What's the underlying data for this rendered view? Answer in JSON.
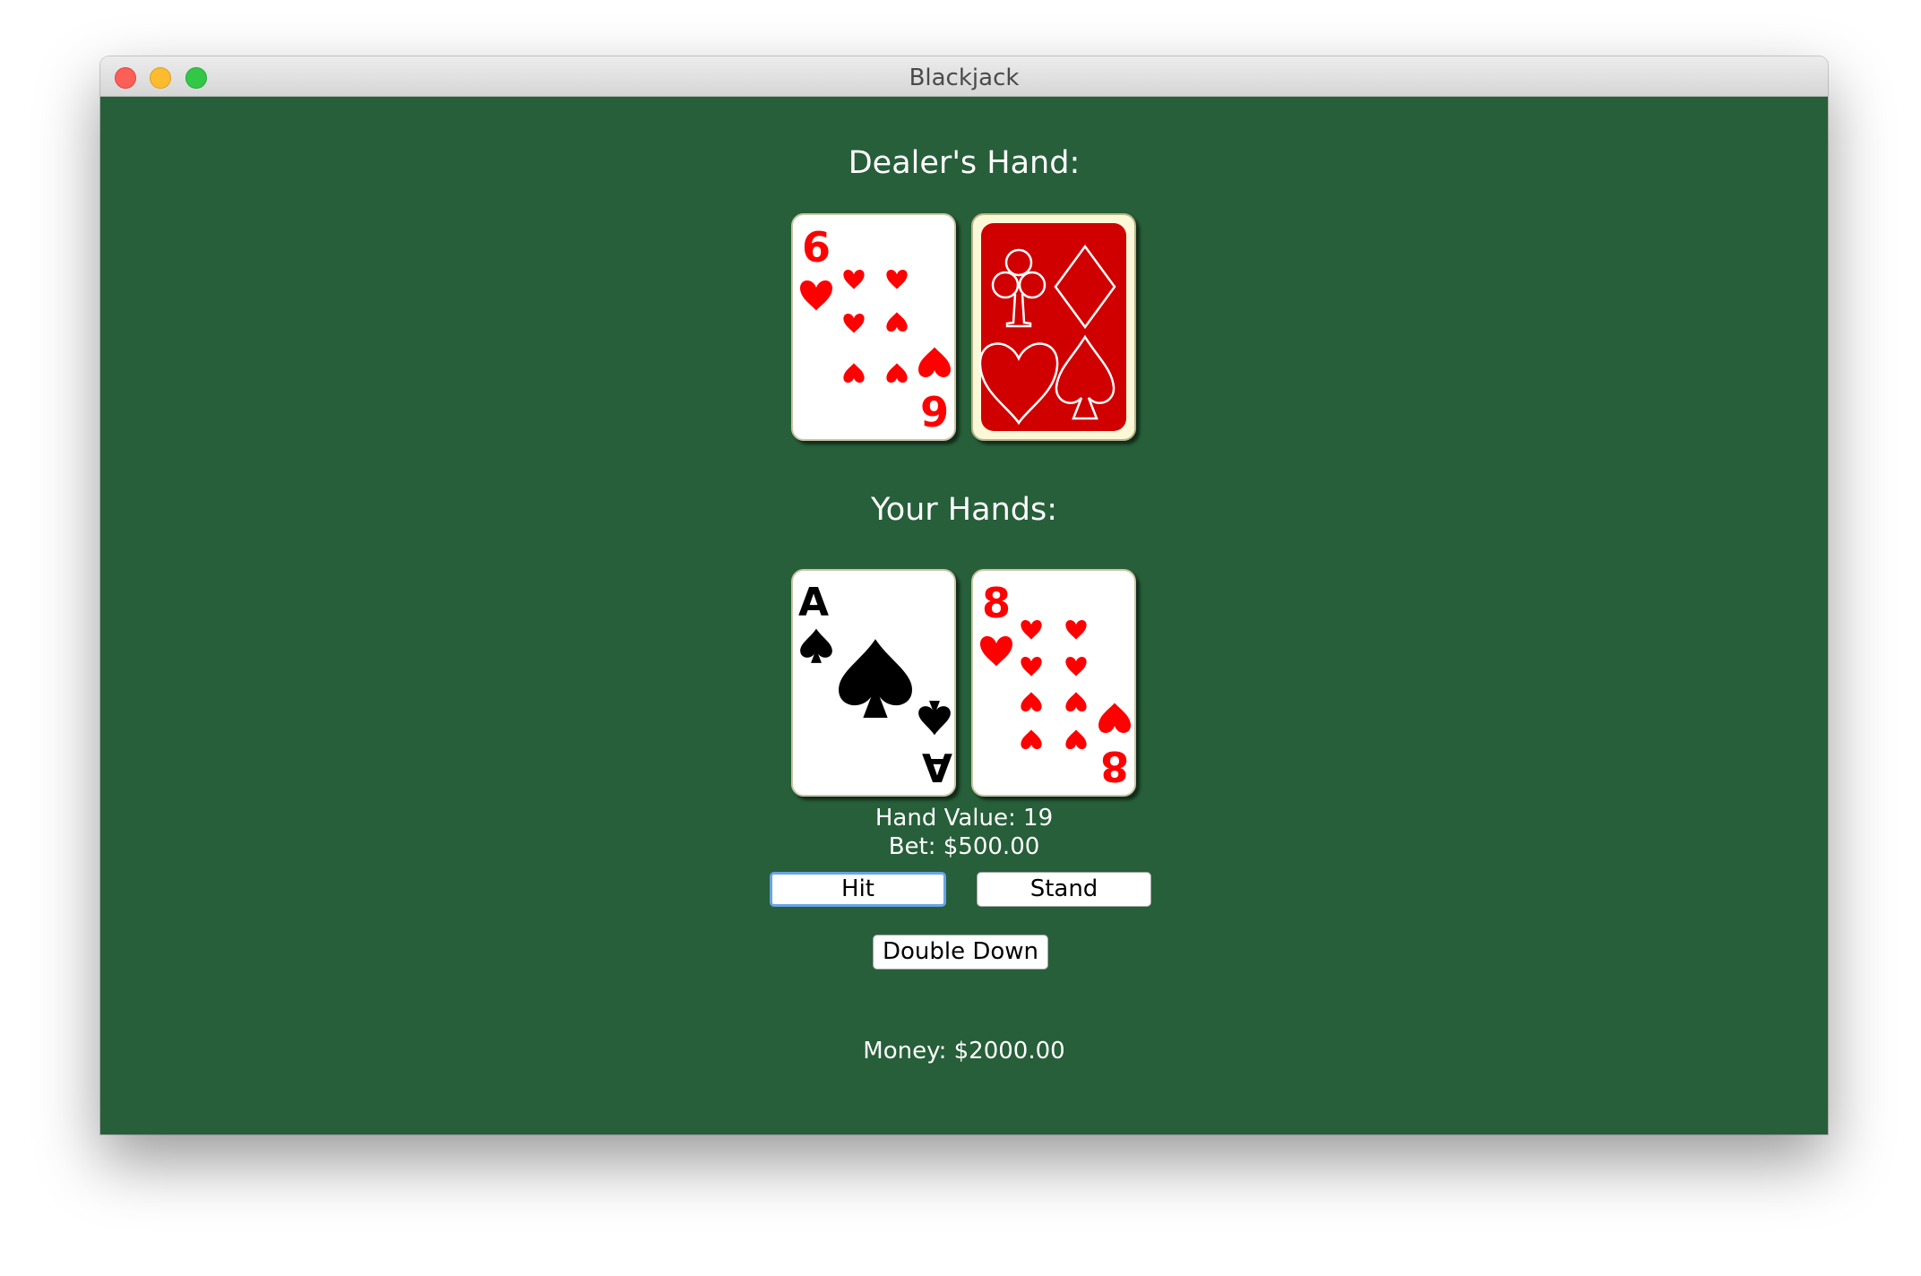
{
  "window": {
    "title": "Blackjack"
  },
  "dealer": {
    "heading": "Dealer's Hand:",
    "cards": [
      {
        "rank": "6",
        "suit": "hearts",
        "color": "#ff0000",
        "face": "up"
      },
      {
        "face": "down",
        "back_color": "#d10000"
      }
    ]
  },
  "player": {
    "heading": "Your Hands:",
    "cards": [
      {
        "rank": "A",
        "suit": "spades",
        "color": "#000000",
        "face": "up"
      },
      {
        "rank": "8",
        "suit": "hearts",
        "color": "#ff0000",
        "face": "up"
      }
    ],
    "hand_value": "Hand Value: 19",
    "bet": "Bet: $500.00"
  },
  "actions": {
    "hit": "Hit",
    "stand": "Stand",
    "double_down": "Double Down"
  },
  "money": "Money: $2000.00",
  "colors": {
    "felt": "#265f39",
    "heart_red": "#ff0000",
    "card_back": "#d10000"
  }
}
